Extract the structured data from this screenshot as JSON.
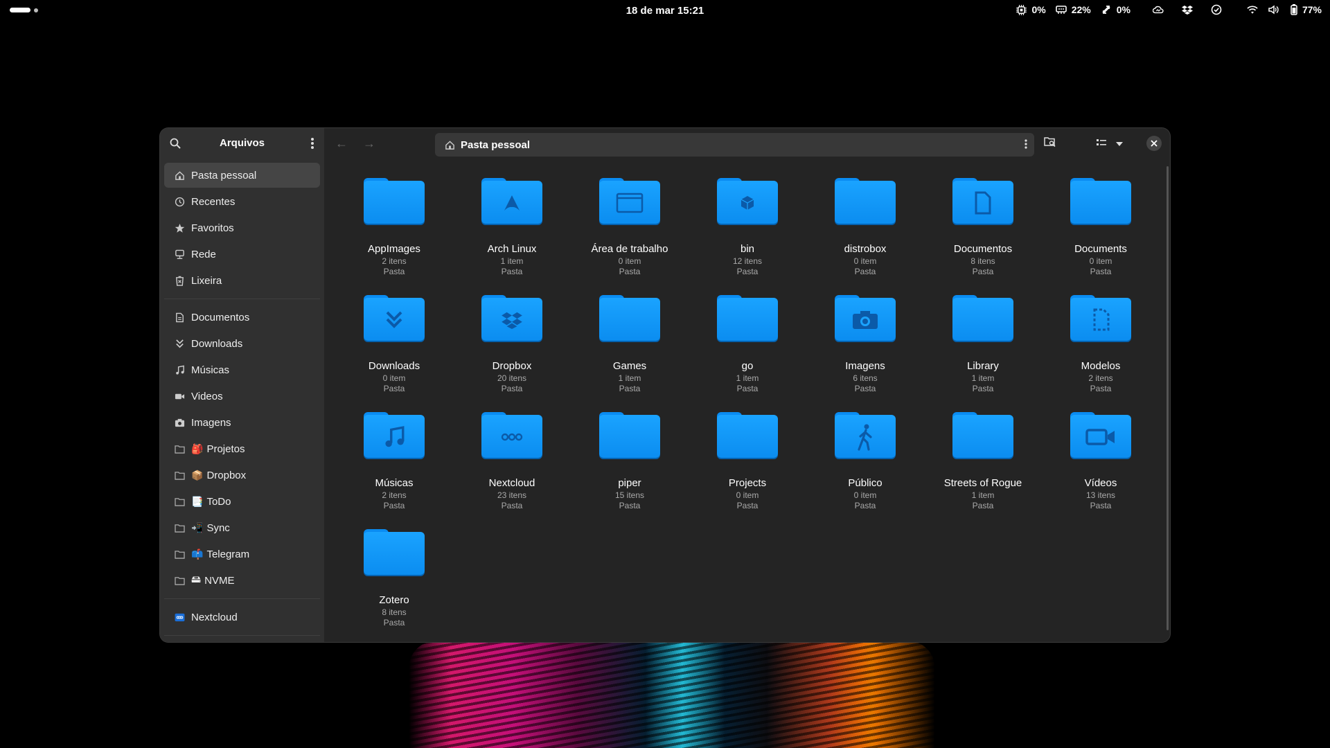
{
  "topbar": {
    "clock": "18 de mar  15:21",
    "cpu": "0%",
    "mem": "22%",
    "swap": "0%",
    "battery": "77%"
  },
  "sidebar": {
    "title": "Arquivos",
    "places": [
      {
        "label": "Pasta pessoal",
        "icon": "home-icon"
      },
      {
        "label": "Recentes",
        "icon": "clock-icon"
      },
      {
        "label": "Favoritos",
        "icon": "star-icon"
      },
      {
        "label": "Rede",
        "icon": "network-icon"
      },
      {
        "label": "Lixeira",
        "icon": "trash-icon"
      }
    ],
    "bookmarks": [
      {
        "label": "Documentos",
        "icon": "document-icon"
      },
      {
        "label": "Downloads",
        "icon": "download-icon"
      },
      {
        "label": "Músicas",
        "icon": "music-icon"
      },
      {
        "label": "Videos",
        "icon": "video-icon"
      },
      {
        "label": "Imagens",
        "icon": "camera-icon"
      },
      {
        "label": "Projetos",
        "emoji": "🎒"
      },
      {
        "label": "Dropbox",
        "emoji": "📦"
      },
      {
        "label": "ToDo",
        "emoji": "📑"
      },
      {
        "label": "Sync",
        "emoji": "📲"
      },
      {
        "label": "Telegram",
        "emoji": "📫"
      },
      {
        "label": "NVME",
        "emoji": "🖴"
      }
    ],
    "mounts": [
      {
        "label": "Nextcloud"
      }
    ]
  },
  "header": {
    "path": "Pasta pessoal"
  },
  "folders": [
    {
      "name": "AppImages",
      "count": "2 itens",
      "type": "Pasta"
    },
    {
      "name": "Arch Linux",
      "count": "1 item",
      "type": "Pasta"
    },
    {
      "name": "Área de trabalho",
      "count": "0 item",
      "type": "Pasta"
    },
    {
      "name": "bin",
      "count": "12 itens",
      "type": "Pasta"
    },
    {
      "name": "distrobox",
      "count": "0 item",
      "type": "Pasta"
    },
    {
      "name": "Documentos",
      "count": "8 itens",
      "type": "Pasta"
    },
    {
      "name": "Documents",
      "count": "0 item",
      "type": "Pasta"
    },
    {
      "name": "Downloads",
      "count": "0 item",
      "type": "Pasta"
    },
    {
      "name": "Dropbox",
      "count": "20 itens",
      "type": "Pasta"
    },
    {
      "name": "Games",
      "count": "1 item",
      "type": "Pasta"
    },
    {
      "name": "go",
      "count": "1 item",
      "type": "Pasta"
    },
    {
      "name": "Imagens",
      "count": "6 itens",
      "type": "Pasta"
    },
    {
      "name": "Library",
      "count": "1 item",
      "type": "Pasta"
    },
    {
      "name": "Modelos",
      "count": "2 itens",
      "type": "Pasta"
    },
    {
      "name": "Músicas",
      "count": "2 itens",
      "type": "Pasta"
    },
    {
      "name": "Nextcloud",
      "count": "23 itens",
      "type": "Pasta"
    },
    {
      "name": "piper",
      "count": "15 itens",
      "type": "Pasta"
    },
    {
      "name": "Projects",
      "count": "0 item",
      "type": "Pasta"
    },
    {
      "name": "Público",
      "count": "0 item",
      "type": "Pasta"
    },
    {
      "name": "Streets of Rogue",
      "count": "1 item",
      "type": "Pasta"
    },
    {
      "name": "Vídeos",
      "count": "13 itens",
      "type": "Pasta"
    },
    {
      "name": "Zotero",
      "count": "8 itens",
      "type": "Pasta"
    }
  ]
}
